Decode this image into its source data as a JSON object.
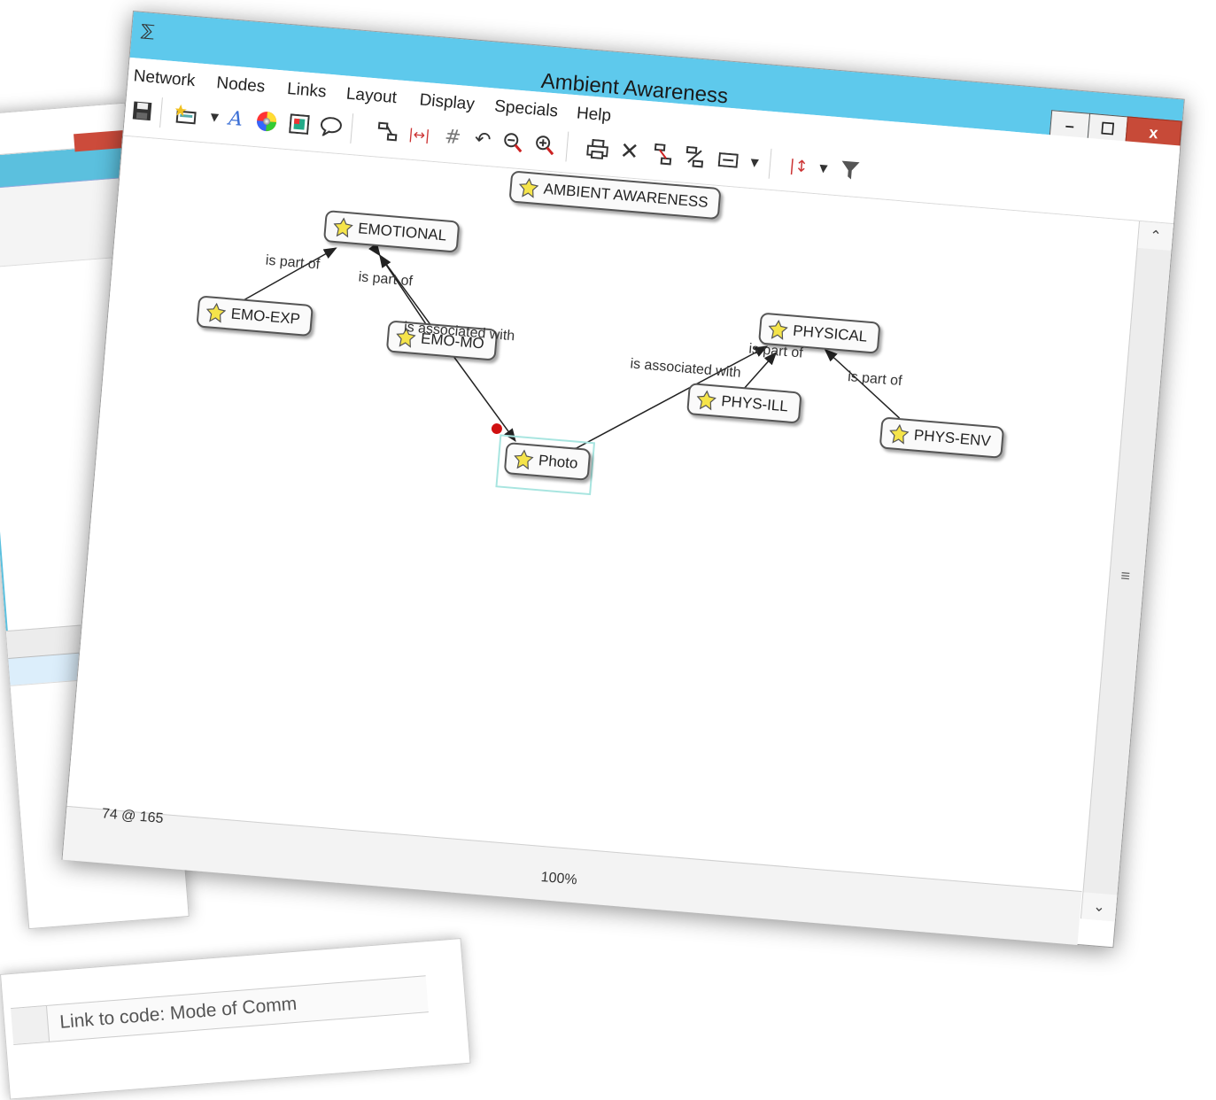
{
  "window": {
    "title": "Ambient Awareness",
    "app_icon": "network-app-icon",
    "controls": {
      "minimize": "–",
      "maximize": "☐",
      "close": "x"
    }
  },
  "menu": [
    "Network",
    "Nodes",
    "Links",
    "Layout",
    "Display",
    "Specials",
    "Help"
  ],
  "toolbar": [
    "save-icon",
    "new-node-icon",
    "dropdown-arrow-icon",
    "font-icon",
    "color-wheel-icon",
    "image-icon",
    "comment-icon",
    "layout-tree-icon",
    "spread-icon",
    "grid-icon",
    "undo-icon",
    "zoom-out-icon",
    "zoom-in-icon",
    "print-icon",
    "delete-icon",
    "link-nodes-icon",
    "split-links-icon",
    "display-options-icon",
    "dropdown-arrow-icon",
    "sort-icon",
    "dropdown-arrow-icon",
    "filter-icon"
  ],
  "nodes": {
    "ambient": "AMBIENT AWARENESS",
    "emotional": "EMOTIONAL",
    "emo_exp": "EMO-EXP",
    "emo_mo": "EMO-MO",
    "physical": "PHYSICAL",
    "phys_ill": "PHYS-ILL",
    "phys_env": "PHYS-ENV",
    "photo": "Photo"
  },
  "edge_labels": {
    "emo_exp_part_of": "is part of",
    "emo_mo_part_of": "is part of",
    "photo_assoc_emotional": "is associated with",
    "photo_assoc_physical": "is associated with",
    "phys_ill_part_of": "is part of",
    "phys_env_part_of": "is part of"
  },
  "status": {
    "coords": "74 @ 165",
    "zoom": "100%"
  },
  "background": {
    "code_link": "Link to code: Mode of Comm"
  },
  "colors": {
    "title_bar": "#5ec9ec",
    "close_button": "#c74a38",
    "node_icon": "#f5e44a",
    "selection_frame": "#a8e5e0",
    "red_dot": "#d01010"
  }
}
